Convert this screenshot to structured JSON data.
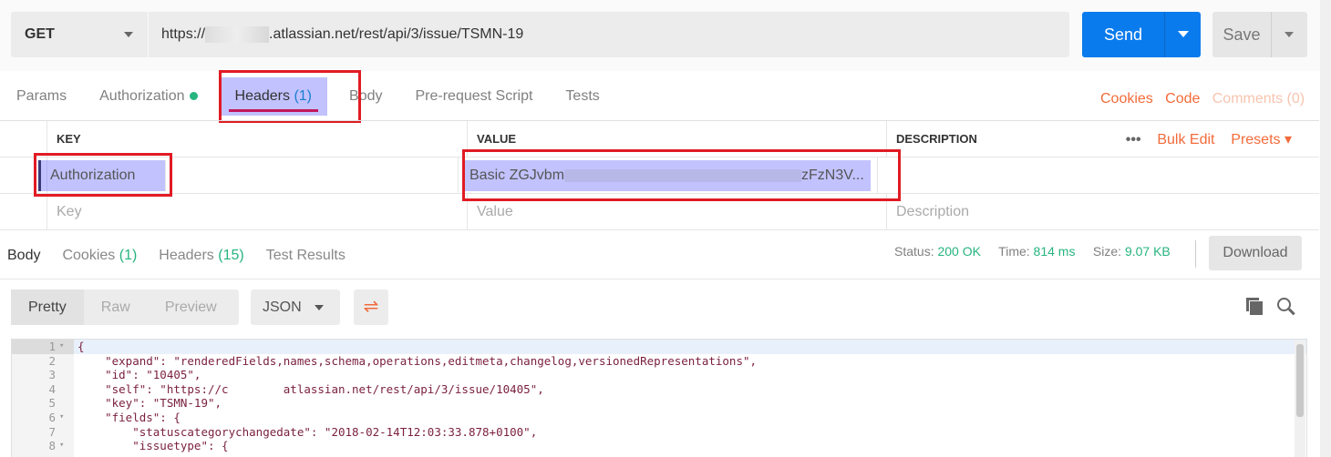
{
  "request": {
    "method": "GET",
    "url_prefix": "https://",
    "url_suffix": ".atlassian.net/rest/api/3/issue/TSMN-19",
    "send_label": "Send",
    "save_label": "Save"
  },
  "tabs": [
    {
      "label": "Params"
    },
    {
      "label": "Authorization"
    },
    {
      "label": "Headers",
      "count": "(1)"
    },
    {
      "label": "Body"
    },
    {
      "label": "Pre-request Script"
    },
    {
      "label": "Tests"
    }
  ],
  "links": {
    "cookies": "Cookies",
    "code": "Code",
    "comments": "Comments (0)"
  },
  "headers_table": {
    "columns": [
      "KEY",
      "VALUE",
      "DESCRIPTION"
    ],
    "bulk_edit": "Bulk Edit",
    "presets": "Presets",
    "rows": [
      {
        "key": "Authorization",
        "value_start": "Basic ZGJvbm",
        "value_end": "zFzN3V..."
      }
    ],
    "placeholder": {
      "key": "Key",
      "value": "Value",
      "description": "Description"
    }
  },
  "response": {
    "tabs": [
      {
        "label": "Body"
      },
      {
        "label": "Cookies",
        "count": "(1)"
      },
      {
        "label": "Headers",
        "count": "(15)"
      },
      {
        "label": "Test Results"
      }
    ],
    "status_label": "Status:",
    "status": "200 OK",
    "time_label": "Time:",
    "time": "814 ms",
    "size_label": "Size:",
    "size": "9.07 KB",
    "download": "Download"
  },
  "viewer": {
    "modes": [
      "Pretty",
      "Raw",
      "Preview"
    ],
    "format": "JSON"
  },
  "code_lines": [
    {
      "n": "1",
      "fold": "▾",
      "text": "{"
    },
    {
      "n": "2",
      "fold": "",
      "text": "    \"expand\": \"renderedFields,names,schema,operations,editmeta,changelog,versionedRepresentations\","
    },
    {
      "n": "3",
      "fold": "",
      "text": "    \"id\": \"10405\","
    },
    {
      "n": "4",
      "fold": "",
      "text": "    \"self\": \"https://c        atlassian.net/rest/api/3/issue/10405\","
    },
    {
      "n": "5",
      "fold": "",
      "text": "    \"key\": \"TSMN-19\","
    },
    {
      "n": "6",
      "fold": "▾",
      "text": "    \"fields\": {"
    },
    {
      "n": "7",
      "fold": "",
      "text": "        \"statuscategorychangedate\": \"2018-02-14T12:03:33.878+0100\","
    },
    {
      "n": "8",
      "fold": "▾",
      "text": "        \"issuetype\": {"
    }
  ]
}
